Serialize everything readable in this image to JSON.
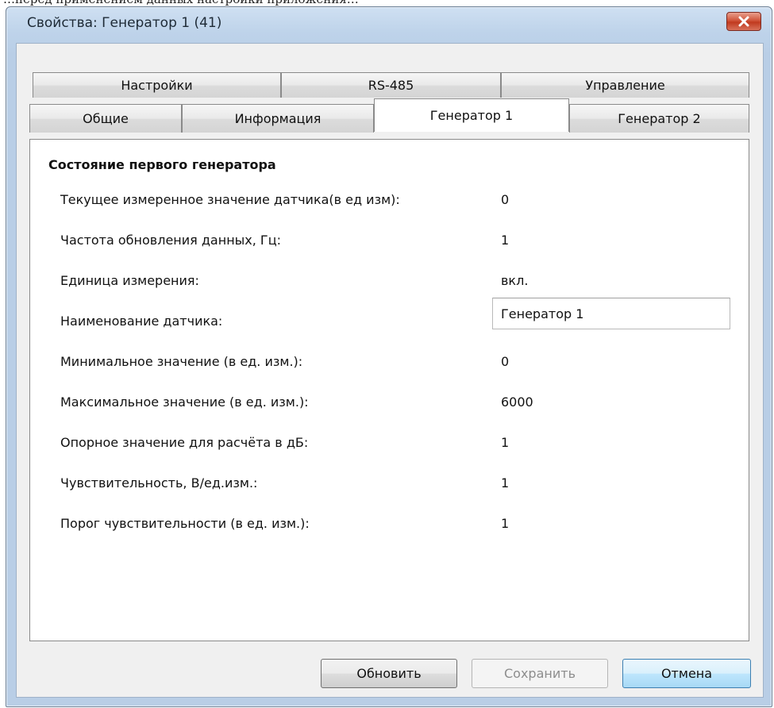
{
  "window": {
    "title": "Свойства: Генератор 1 (41)",
    "close_glyph": "✕"
  },
  "tabs_row1": [
    {
      "label": "Настройки"
    },
    {
      "label": "RS-485"
    },
    {
      "label": "Управление"
    }
  ],
  "tabs_row2": [
    {
      "label": "Общие"
    },
    {
      "label": "Информация"
    },
    {
      "label": "Генератор 1",
      "active": true
    },
    {
      "label": "Генератор 2"
    }
  ],
  "panel": {
    "section_title": "Состояние первого генератора",
    "rows": [
      {
        "label": "Текущее измеренное значение датчика(в ед изм):",
        "value": "0"
      },
      {
        "label": "Частота обновления данных, Гц:",
        "value": "1"
      },
      {
        "label": "Единица измерения:",
        "value": "вкл."
      },
      {
        "label": "Наименование датчика:",
        "value": "Генератор 1"
      },
      {
        "label": "Минимальное значение (в ед. изм.):",
        "value": "0"
      },
      {
        "label": "Максимальное значение (в ед. изм.):",
        "value": "6000"
      },
      {
        "label": "Опорное значение для расчёта в дБ:",
        "value": "1"
      },
      {
        "label": "Чувствительность, В/ед.изм.:",
        "value": "1"
      },
      {
        "label": "Порог чувствительности (в ед. изм.):",
        "value": "1"
      }
    ]
  },
  "buttons": {
    "refresh": "Обновить",
    "save": "Сохранить",
    "cancel": "Отмена"
  },
  "colors": {
    "close_button": "#c13a1f",
    "default_button_border": "#3c7fb1",
    "window_frame": "#bed3ea"
  }
}
